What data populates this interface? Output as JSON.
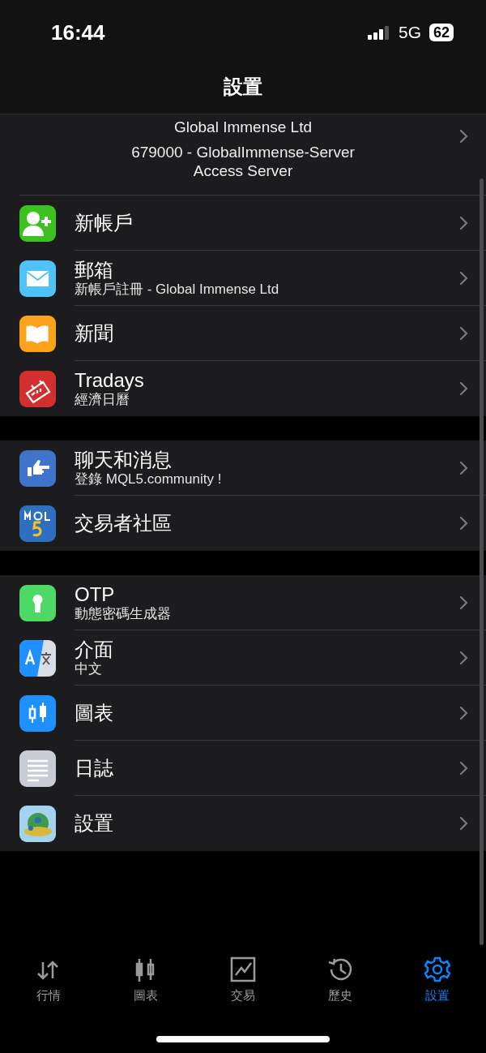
{
  "status_bar": {
    "time": "16:44",
    "network": "5G",
    "battery": "62"
  },
  "title": "設置",
  "account": {
    "company": "Global Immense Ltd",
    "server": "679000 - GlobalImmense-Server",
    "access": "Access Server"
  },
  "groups": [
    {
      "items": [
        {
          "kind": "adduser",
          "title": "新帳戶"
        },
        {
          "kind": "mail",
          "title": "郵箱",
          "subtitle": "新帳戶註冊 - Global Immense Ltd"
        },
        {
          "kind": "book",
          "title": "新聞"
        },
        {
          "kind": "calendar",
          "title": "Tradays",
          "subtitle": "經濟日曆"
        }
      ]
    },
    {
      "items": [
        {
          "kind": "hand",
          "title": "聊天和消息",
          "subtitle": "登錄 MQL5.community !"
        },
        {
          "kind": "mql",
          "title": "交易者社區"
        }
      ]
    },
    {
      "items": [
        {
          "kind": "keyhole",
          "title": "OTP",
          "subtitle": "動態密碼生成器"
        },
        {
          "kind": "language",
          "title": "介面",
          "subtitle": "中文"
        },
        {
          "kind": "candles",
          "title": "圖表"
        },
        {
          "kind": "lines",
          "title": "日誌"
        },
        {
          "kind": "globe",
          "title": "設置"
        }
      ]
    }
  ],
  "tabs": [
    {
      "kind": "arrows",
      "label": "行情",
      "selected": false
    },
    {
      "kind": "candles",
      "label": "圖表",
      "selected": false
    },
    {
      "kind": "chart",
      "label": "交易",
      "selected": false
    },
    {
      "kind": "history",
      "label": "歷史",
      "selected": false
    },
    {
      "kind": "gear",
      "label": "設置",
      "selected": true
    }
  ]
}
